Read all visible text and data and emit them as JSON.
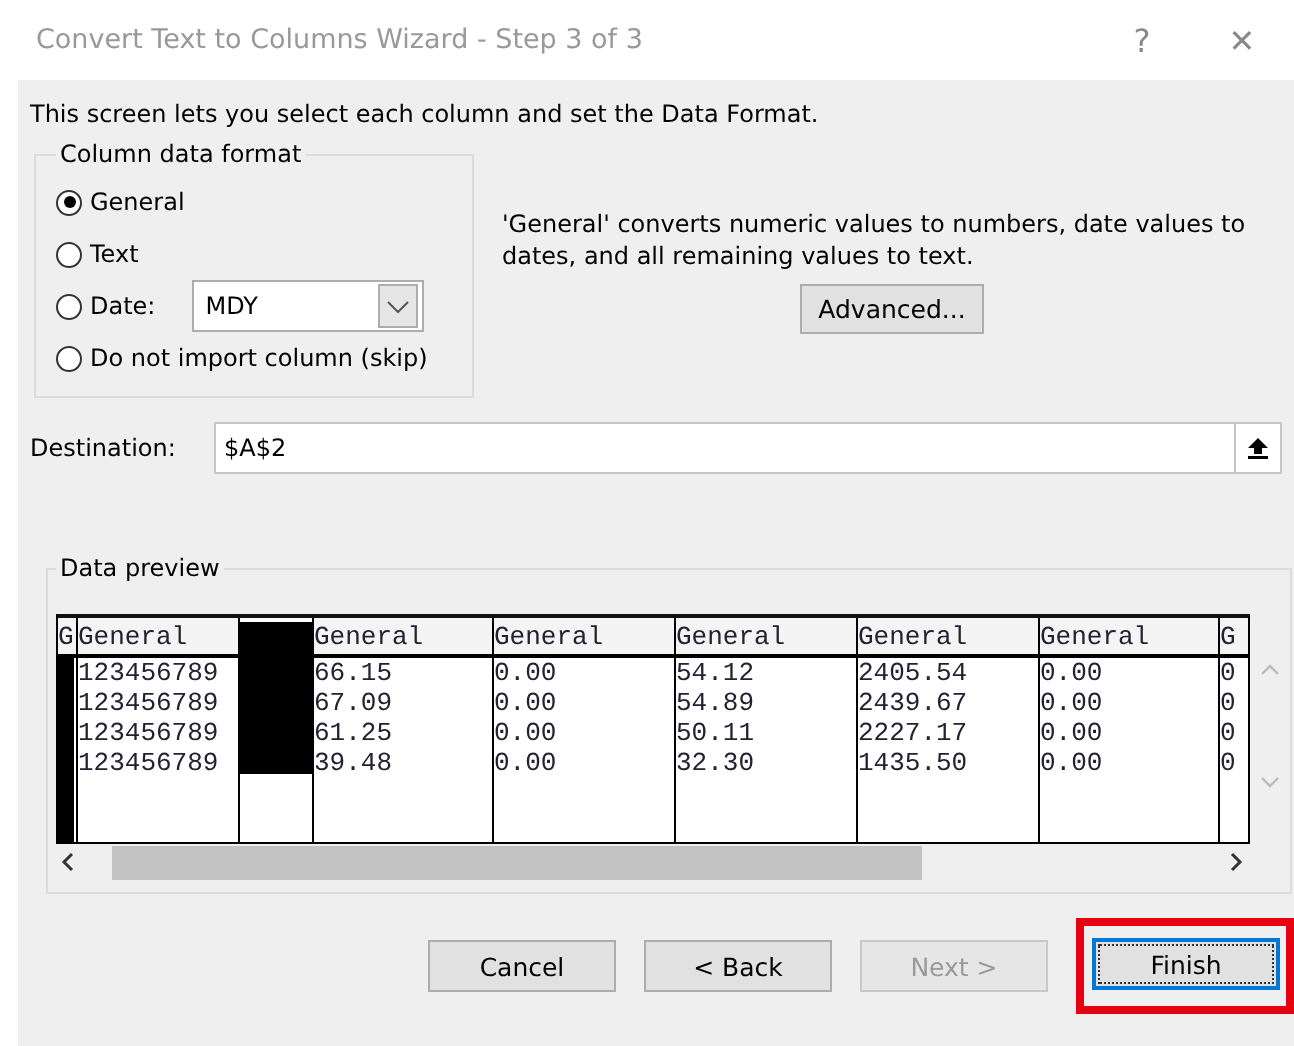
{
  "window": {
    "title": "Convert Text to Columns Wizard - Step 3 of 3",
    "controls": [
      "?",
      "✕"
    ]
  },
  "intro": "This screen lets you select each column and set the Data Format.",
  "format_group": {
    "title": "Column data format",
    "options": [
      {
        "label": "General",
        "selected": true,
        "kind": "plain"
      },
      {
        "label": "Text",
        "selected": false,
        "kind": "plain"
      },
      {
        "label": "Date:",
        "selected": false,
        "kind": "date",
        "dropdown": "MDY"
      },
      {
        "label": "Do not import column (skip)",
        "selected": false,
        "kind": "plain"
      }
    ]
  },
  "description": "'General' converts numeric values to numbers, date values to dates, and all remaining values to text.",
  "advanced_button": "Advanced...",
  "destination": {
    "label": "Destination:",
    "value": "$A$2"
  },
  "preview": {
    "title": "Data preview",
    "columns": [
      {
        "header": "G",
        "redacted": true
      },
      {
        "header": "General",
        "cells": [
          "123456789",
          "123456789",
          "123456789",
          "123456789"
        ],
        "redacted": false
      },
      {
        "redacted": true
      },
      {
        "header": "General",
        "cells": [
          "66.15",
          "67.09",
          "61.25",
          "39.48"
        ],
        "redacted": false
      },
      {
        "header": "General",
        "cells": [
          "0.00",
          "0.00",
          "0.00",
          "0.00"
        ],
        "redacted": false
      },
      {
        "header": "General",
        "cells": [
          "54.12",
          "54.89",
          "50.11",
          "32.30"
        ],
        "redacted": false
      },
      {
        "header": "General",
        "cells": [
          "2405.54",
          "2439.67",
          "2227.17",
          "1435.50"
        ],
        "redacted": false
      },
      {
        "header": "General",
        "cells": [
          "0.00",
          "0.00",
          "0.00",
          "0.00"
        ],
        "redacted": false
      },
      {
        "header": "G",
        "cells": [
          "0",
          "0",
          "0",
          "0"
        ],
        "redacted": false
      }
    ]
  },
  "buttons": [
    {
      "label": "Cancel",
      "disabled": false,
      "highlighted": false
    },
    {
      "label": "< Back",
      "disabled": false,
      "highlighted": false
    },
    {
      "label": "Next >",
      "disabled": true,
      "highlighted": false
    },
    {
      "label": "Finish",
      "disabled": false,
      "highlighted": true
    }
  ]
}
